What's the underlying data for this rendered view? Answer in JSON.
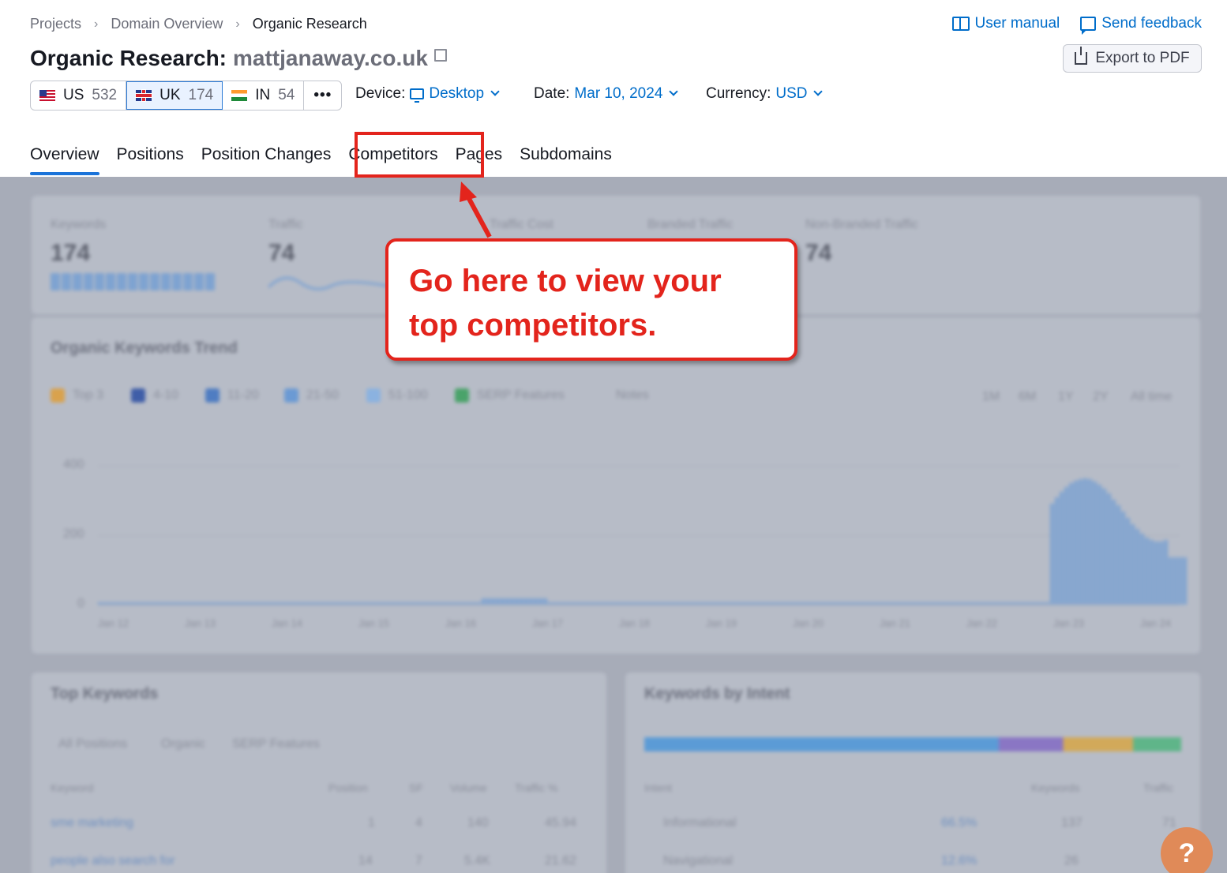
{
  "breadcrumb": [
    "Projects",
    "Domain Overview",
    "Organic Research"
  ],
  "toplinks": {
    "manual": "User manual",
    "feedback": "Send feedback"
  },
  "title": {
    "label": "Organic Research:",
    "domain": "mattjanaway.co.uk"
  },
  "export": "Export to PDF",
  "databases": [
    {
      "code": "US",
      "count": "532"
    },
    {
      "code": "UK",
      "count": "174"
    },
    {
      "code": "IN",
      "count": "54"
    }
  ],
  "more": "•••",
  "filters": {
    "device_label": "Device:",
    "device_value": "Desktop",
    "date_label": "Date:",
    "date_value": "Mar 10, 2024",
    "currency_label": "Currency:",
    "currency_value": "USD"
  },
  "tabs": [
    "Overview",
    "Positions",
    "Position Changes",
    "Competitors",
    "Pages",
    "Subdomains"
  ],
  "callout": "Go here to view your top competitors.",
  "blurred": {
    "metrics": [
      {
        "label": "Keywords",
        "value": "174"
      },
      {
        "label": "Traffic",
        "value": "74"
      },
      {
        "label": "Traffic Cost",
        "value": ""
      },
      {
        "label": "Branded Traffic",
        "value": ""
      },
      {
        "label": "Non-Branded Traffic",
        "value": "74"
      }
    ],
    "trend_title": "Organic Keywords Trend",
    "legend": [
      "Top 3",
      "4-10",
      "11-20",
      "21-50",
      "51-100",
      "SERP Features",
      "Notes"
    ],
    "ranges": [
      "1M",
      "6M",
      "1Y",
      "2Y",
      "All time"
    ],
    "y_ticks": [
      "400",
      "200",
      "0"
    ],
    "x_ticks": [
      "Jan 12",
      "Jan 13",
      "Jan 14",
      "Jan 15",
      "Jan 16",
      "Jan 17",
      "Jan 18",
      "Jan 19",
      "Jan 20",
      "Jan 21",
      "Jan 22",
      "Jan 23",
      "Jan 24"
    ],
    "top_keywords_title": "Top Keywords",
    "top_keywords_tabs": [
      "All Positions",
      "Organic",
      "SERP Features"
    ],
    "top_keywords_cols": [
      "Keyword",
      "Position",
      "SF",
      "Volume",
      "Traffic %"
    ],
    "top_keywords_rows": [
      [
        "sme marketing",
        "1",
        "4",
        "140",
        "45.94"
      ],
      [
        "people also search for",
        "14",
        "7",
        "5.4K",
        "21.62"
      ]
    ],
    "intent_title": "Keywords by Intent",
    "intent_cols": [
      "Intent",
      "Keywords",
      "Traffic"
    ],
    "intent_rows": [
      [
        "Informational",
        "66.5%",
        "137",
        "71"
      ],
      [
        "Navigational",
        "12.6%",
        "26",
        ""
      ]
    ],
    "help": "?"
  },
  "colors": {
    "accent": "#006dca",
    "highlight": "#e3241c"
  }
}
